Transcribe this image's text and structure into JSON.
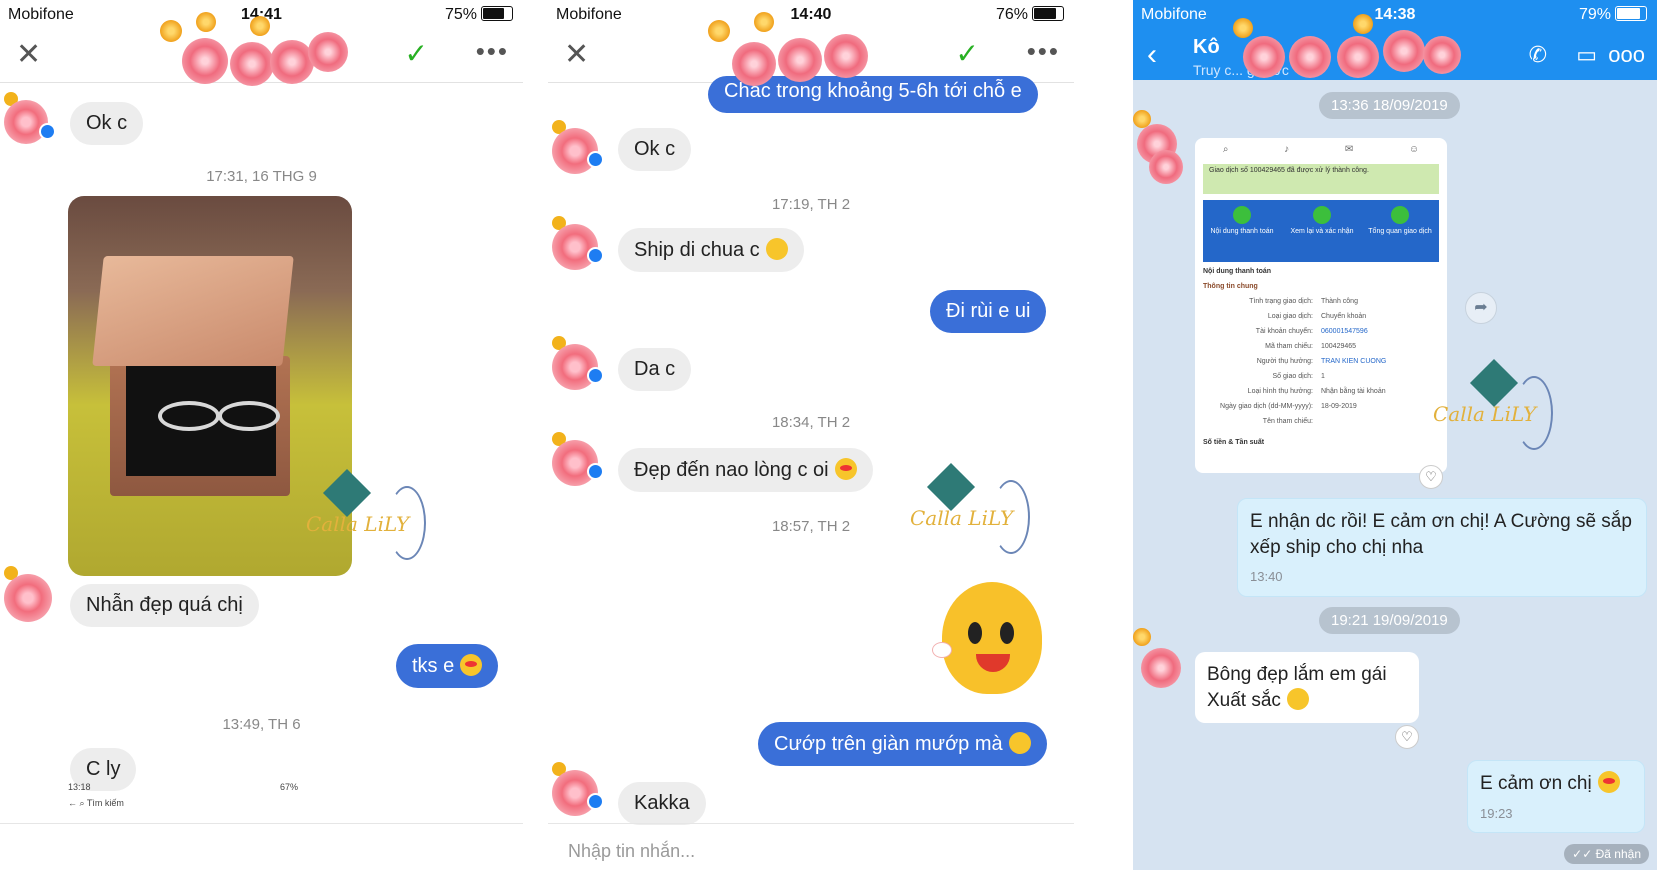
{
  "panel1": {
    "status": {
      "carrier": "Mobifone",
      "time": "14:41",
      "battery": "75%"
    },
    "messages": {
      "ok": "Ok c",
      "ts1": "17:31, 16 THG 9",
      "nhan": "Nhẫn đẹp quá chị",
      "tks": "tks e",
      "ts2": "13:49, TH 6",
      "cly": "C ly"
    },
    "mini": {
      "time": "13:18",
      "battery": "67%",
      "search": "Tìm kiếm"
    }
  },
  "panel2": {
    "status": {
      "carrier": "Mobifone",
      "time": "14:40",
      "battery": "76%"
    },
    "messages": {
      "top": "Chắc trong khoảng 5-6h tới chỗ e",
      "ok": "Ok c",
      "ts1": "17:19, TH 2",
      "ship": "Ship di chua c",
      "dirui": "Đi rùi e ui",
      "dac": "Da c",
      "ts2": "18:34, TH 2",
      "dep": "Đẹp đến nao lòng c oi",
      "ts3": "18:57, TH 2",
      "cuop": "Cướp trên giàn mướp mà",
      "kakka": "Kakka"
    },
    "input_placeholder": "Nhập tin nhắn..."
  },
  "panel3": {
    "status": {
      "carrier": "Mobifone",
      "time": "14:38",
      "battery": "79%"
    },
    "header": {
      "name": "Kô",
      "sub": "Truy c... g  rước"
    },
    "chip1": "13:36 18/09/2019",
    "receipt": {
      "success": "Giao dịch số 100429465 đã được xử lý thành công.",
      "steps": [
        "Nội dung thanh toán",
        "Xem lại và xác nhận",
        "Tổng quan giao dịch"
      ],
      "section": "Nội dung thanh toán",
      "subsection": "Thông tin chung",
      "rows": [
        {
          "k": "Tình trạng giao dịch:",
          "v": "Thành công"
        },
        {
          "k": "Loại giao dịch:",
          "v": "Chuyển khoản"
        },
        {
          "k": "Tài khoản chuyển:",
          "v": "060001547596"
        },
        {
          "k": "Mã tham chiếu:",
          "v": "100429465"
        },
        {
          "k": "Người thụ hưởng:",
          "v": "TRAN KIEN CUONG"
        },
        {
          "k": "Số giao dịch:",
          "v": "1"
        },
        {
          "k": "Loại hình thụ hưởng:",
          "v": "Nhận bằng tài khoản"
        },
        {
          "k": "Ngày giao dịch (dd-MM-yyyy):",
          "v": "18-09-2019"
        },
        {
          "k": "Tên tham chiếu:",
          "v": ""
        }
      ],
      "footer": "Số tiền & Tần suất"
    },
    "msg1": {
      "text": "E nhận dc rồi! E cảm ơn chị! A Cường sẽ sắp xếp ship cho chị nha",
      "time": "13:40"
    },
    "chip2": "19:21 19/09/2019",
    "msg2": {
      "line1": "Bông đẹp lắm em gái",
      "line2": "Xuất sắc"
    },
    "msg3": {
      "text": "E cảm ơn chị",
      "time": "19:23"
    },
    "received": "Đã nhận"
  },
  "watermark": {
    "text": "Calla LiLY"
  }
}
